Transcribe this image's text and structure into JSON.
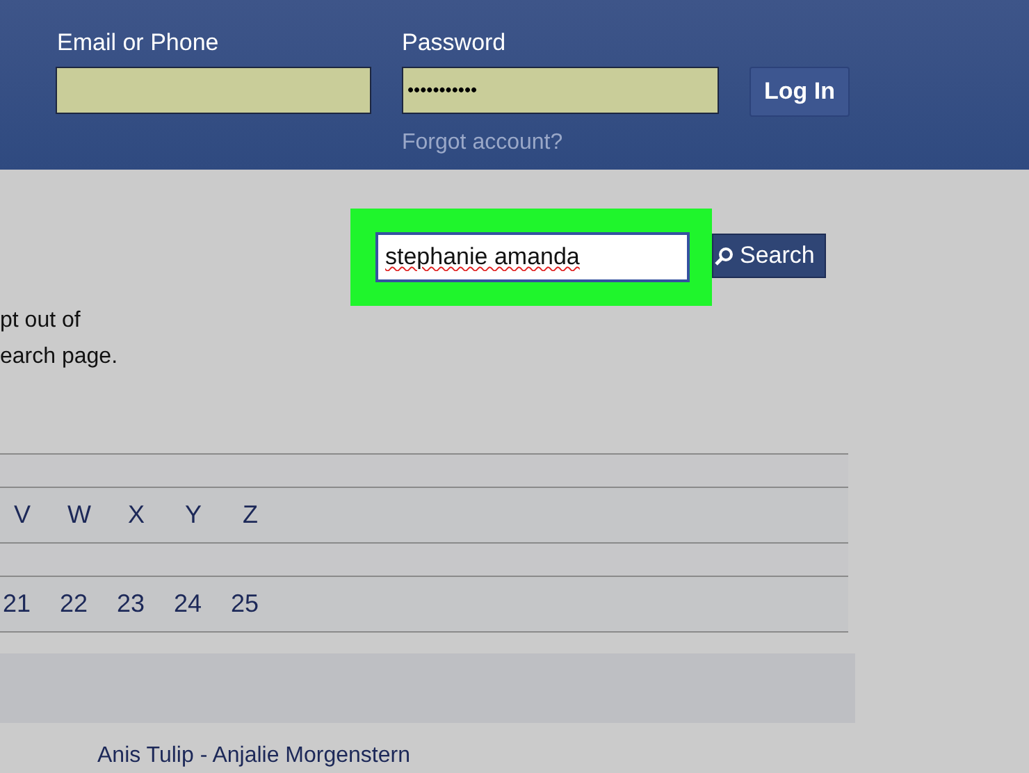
{
  "header": {
    "email_label": "Email or Phone",
    "password_label": "Password",
    "password_value": "•••••••••••",
    "login_button": "Log In",
    "forgot_link": "Forgot account?"
  },
  "search": {
    "value": "stephanie amanda",
    "button": "Search",
    "highlighted": true
  },
  "notice_lines": [
    "pt out of",
    "earch page."
  ],
  "letters": [
    "V",
    "W",
    "X",
    "Y",
    "Z"
  ],
  "pages": [
    "21",
    "22",
    "23",
    "24",
    "25"
  ],
  "result": "Anis Tulip - Anjalie Morgenstern"
}
